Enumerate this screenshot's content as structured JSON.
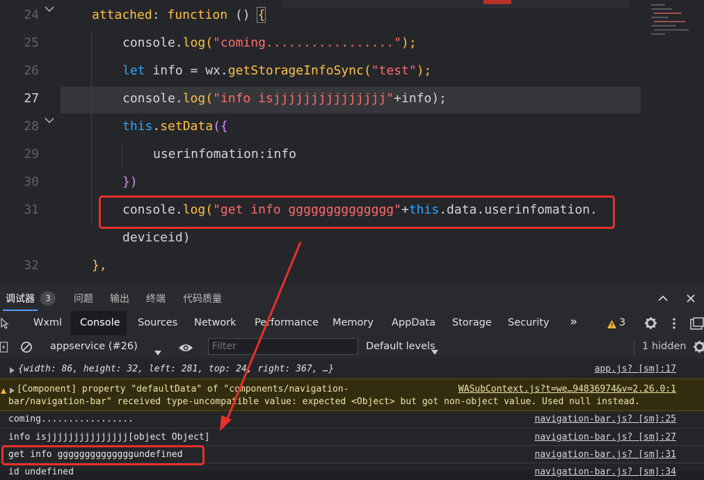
{
  "editor": {
    "line_numbers": [
      "24",
      "25",
      "26",
      "27",
      "28",
      "29",
      "30",
      "31",
      "32"
    ],
    "lines": {
      "l24": {
        "a": "attached",
        "b": ": ",
        "c": "function",
        "d": " () ",
        "e": "{"
      },
      "l25": {
        "a": "console",
        "b": ".",
        "c": "log",
        "d": "(",
        "e": "\"coming.................\"",
        "f": ");"
      },
      "l26": {
        "a": "let",
        "b": " info = wx.",
        "c": "getStorageInfoSync",
        "d": "(",
        "e": "\"test\"",
        "f": ");"
      },
      "l27": {
        "a": "console",
        "b": ".",
        "c": "log",
        "d": "(",
        "e": "\"info isjjjjjjjjjjjjjjj\"",
        "f": "+info);"
      },
      "l28": {
        "a": "this",
        "b": ".",
        "c": "setData",
        "d": "({"
      },
      "l29": {
        "a": "userinfomation:info"
      },
      "l30": {
        "a": "})"
      },
      "l31": {
        "a": "console",
        "b": ".",
        "c": "log",
        "d": "(",
        "e": "\"get info gggggggggggggg\"",
        "f": "+",
        "g": "this",
        "h": ".data.userinfomation."
      },
      "l31b": {
        "a": "deviceid)"
      },
      "l32": {
        "a": "},"
      }
    }
  },
  "devtools": {
    "top_tabs": [
      "调试器",
      "问题",
      "输出",
      "终端",
      "代码质量"
    ],
    "badge_count": "3",
    "panel_tabs": [
      "Wxml",
      "Console",
      "Sources",
      "Network",
      "Performance",
      "Memory",
      "AppData",
      "Storage",
      "Security"
    ],
    "more_tabs": "»",
    "warning_count": "3",
    "context_select": "appservice (#26)",
    "filter_placeholder": "Filter",
    "levels": "Default levels",
    "hidden": "1 hidden"
  },
  "console": {
    "rows": [
      {
        "msg": "{width: 86, height: 32, left: 281, top: 24, right: 367, …}",
        "src": "app.js? [sm]:17"
      },
      {
        "msg": "[Component] property \"defaultData\" of \"components/navigation-",
        "msg2": "bar/navigation-bar\" received type-uncompatible value: expected <Object> but got non-object value. Used null instead.",
        "src": "WASubContext.js?t=we…94836974&v=2.26.0:1"
      },
      {
        "msg": "coming.................",
        "src": "navigation-bar.js? [sm]:25"
      },
      {
        "msg": "info isjjjjjjjjjjjjjjj[object Object]",
        "src": "navigation-bar.js? [sm]:27"
      },
      {
        "msg": "get info ggggggggggggggundefined",
        "src": "navigation-bar.js? [sm]:31"
      },
      {
        "msg": "id undefined",
        "src": "navigation-bar.js? [sm]:34"
      }
    ]
  },
  "colors": {
    "highlight": "#e8302a",
    "keyword": "#2fa3ff",
    "function": "#ffc145",
    "string": "#ff6b6b"
  }
}
